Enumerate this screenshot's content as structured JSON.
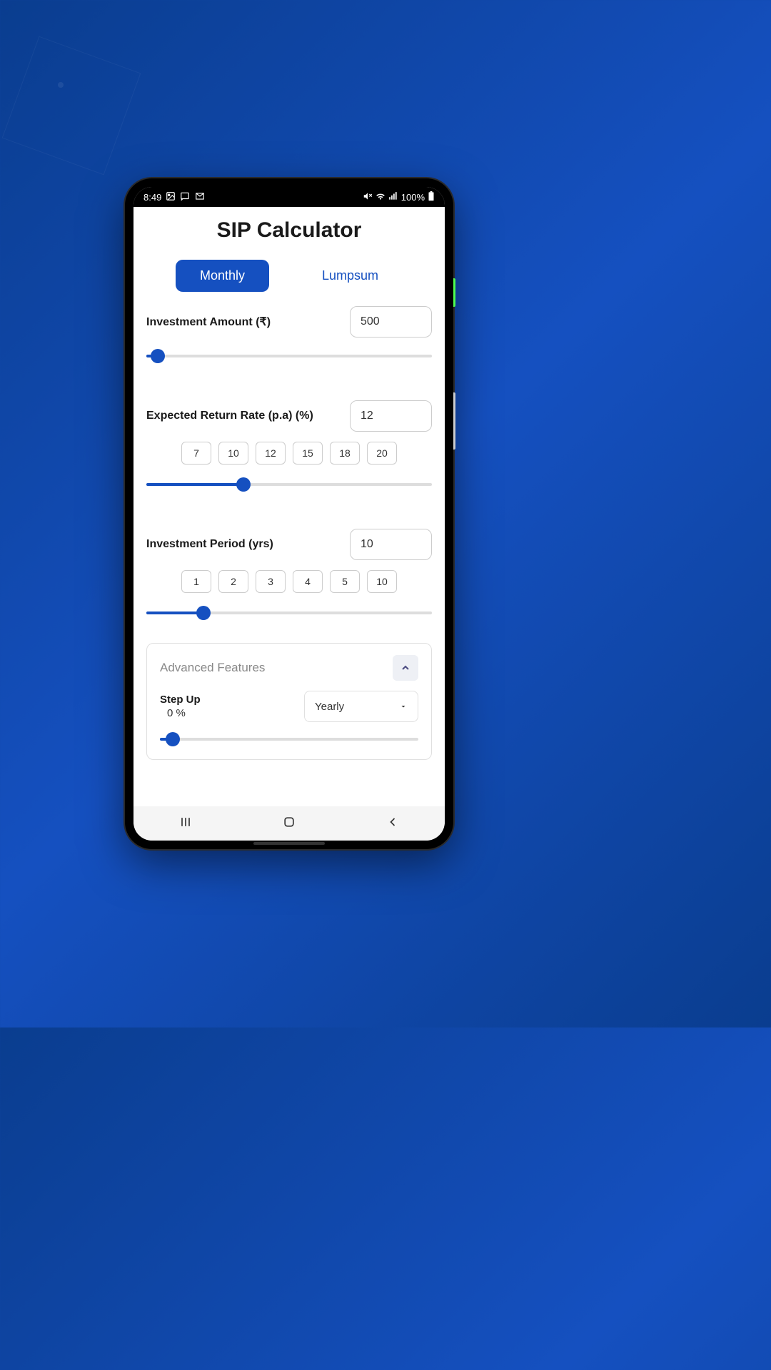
{
  "status_bar": {
    "time": "8:49",
    "battery": "100%"
  },
  "app": {
    "title": "SIP Calculator"
  },
  "tabs": {
    "monthly": "Monthly",
    "lumpsum": "Lumpsum"
  },
  "fields": {
    "amount": {
      "label": "Investment Amount (₹)",
      "value": "500",
      "slider_pct": 4
    },
    "rate": {
      "label": "Expected Return Rate (p.a) (%)",
      "value": "12",
      "chips": [
        "7",
        "10",
        "12",
        "15",
        "18",
        "20"
      ],
      "slider_pct": 34
    },
    "period": {
      "label": "Investment Period (yrs)",
      "value": "10",
      "chips": [
        "1",
        "2",
        "3",
        "4",
        "5",
        "10"
      ],
      "slider_pct": 20
    }
  },
  "advanced": {
    "title": "Advanced Features",
    "stepup": {
      "label": "Step Up",
      "value": "0 %",
      "slider_pct": 5
    },
    "frequency": {
      "selected": "Yearly"
    }
  }
}
